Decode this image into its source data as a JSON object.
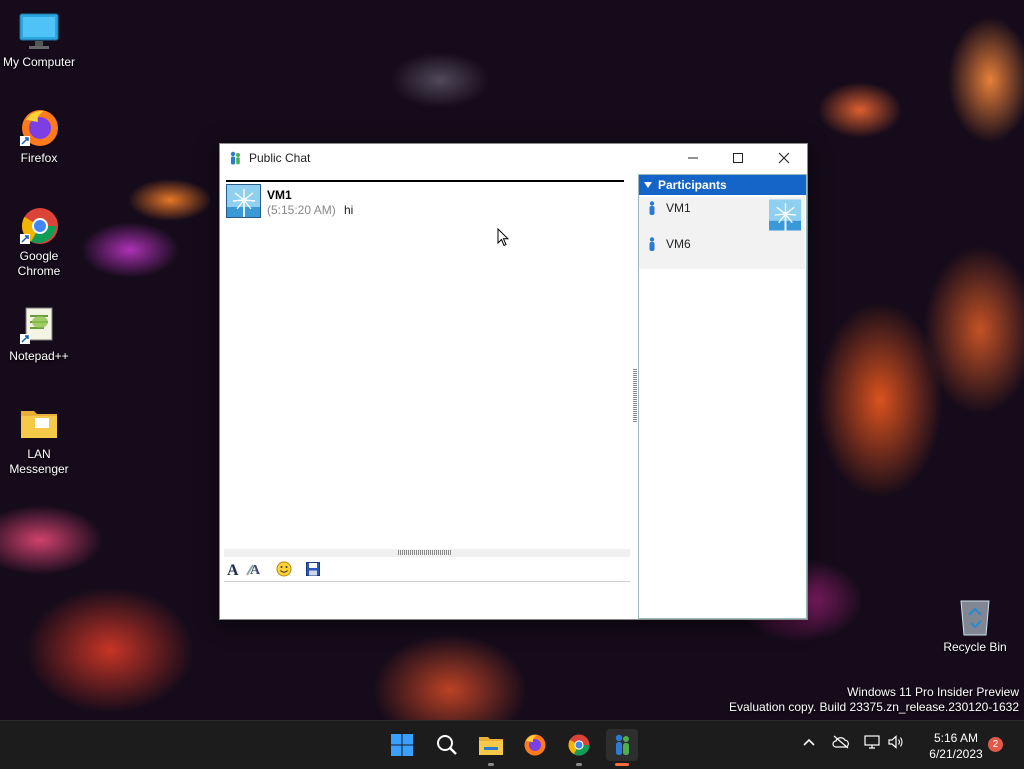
{
  "desktop": {
    "icons": [
      {
        "label": "My Computer"
      },
      {
        "label": "Firefox"
      },
      {
        "label": "Google Chrome"
      },
      {
        "label": "Notepad++"
      },
      {
        "label": "LAN Messenger"
      }
    ],
    "recycle_bin": "Recycle Bin",
    "watermark": {
      "line1": "Windows 11 Pro Insider Preview",
      "line2": "Evaluation copy. Build 23375.zn_release.230120-1632"
    }
  },
  "window": {
    "title": "Public Chat",
    "messages": [
      {
        "sender": "VM1",
        "time": "(5:15:20 AM)",
        "text": "hi"
      }
    ],
    "input": {
      "value": "",
      "placeholder": ""
    },
    "participants": {
      "header": "Participants",
      "list": [
        {
          "name": "VM1"
        },
        {
          "name": "VM6"
        }
      ]
    }
  },
  "taskbar": {
    "clock_time": "5:16 AM",
    "clock_date": "6/21/2023",
    "notification_count": "2"
  },
  "colors": {
    "participants_header": "#1565c8",
    "active_indicator": "#ff6b3d"
  }
}
